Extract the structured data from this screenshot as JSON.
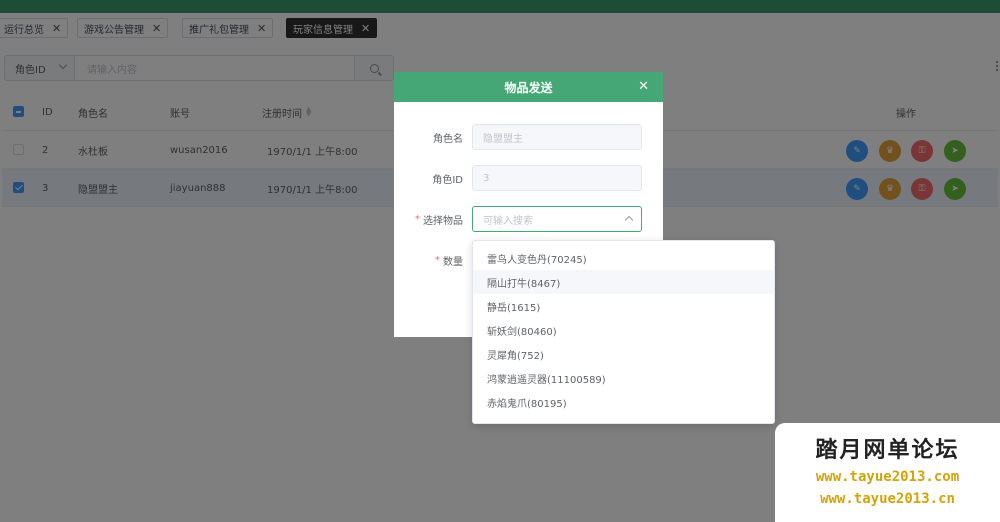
{
  "tabs": [
    {
      "label": "运行总览",
      "active": false
    },
    {
      "label": "游戏公告管理",
      "active": false
    },
    {
      "label": "推广礼包管理",
      "active": false
    },
    {
      "label": "玩家信息管理",
      "active": true
    }
  ],
  "filter": {
    "select_value": "角色ID",
    "search_placeholder": "请输入内容"
  },
  "table": {
    "columns": {
      "id": "ID",
      "name": "角色名",
      "account": "账号",
      "reg_time": "注册时间",
      "actions": "操作"
    },
    "rows": [
      {
        "id": "2",
        "name": "水杜板",
        "account": "wusan2016",
        "reg_time": "1970/1/1 上午8:00",
        "selected": false
      },
      {
        "id": "3",
        "name": "隐盟盟主",
        "account": "jiayuan888",
        "reg_time": "1970/1/1 上午8:00",
        "selected": true
      }
    ],
    "action_colors": [
      "#409eff",
      "#e6a23c",
      "#f56c6c",
      "#67c23a"
    ]
  },
  "dialog": {
    "title": "物品发送",
    "fields": {
      "role_name_label": "角色名",
      "role_name_value": "隐盟盟主",
      "role_id_label": "角色ID",
      "role_id_value": "3",
      "item_label": "选择物品",
      "item_placeholder": "可输入搜索",
      "qty_label": "数量"
    }
  },
  "dropdown": {
    "options": [
      "雷鸟人变色丹(70245)",
      "隔山打牛(8467)",
      "静岳(1615)",
      "斩妖剑(80460)",
      "灵犀角(752)",
      "鸿蒙逍遥灵器(11100589)",
      "赤焰鬼爪(80195)"
    ],
    "hover_index": 1
  },
  "watermark": {
    "title": "踏月网单论坛",
    "url1": "www.tayue2013.com",
    "url2": "www.tayue2013.cn"
  }
}
